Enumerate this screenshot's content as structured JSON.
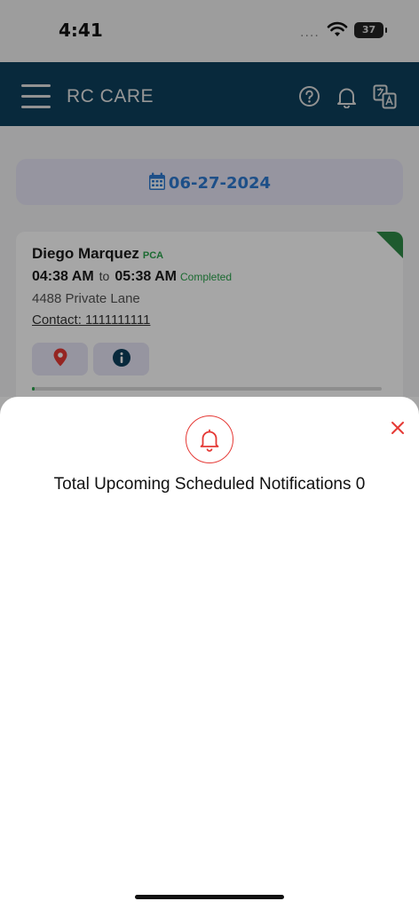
{
  "status_bar": {
    "time": "4:41",
    "signal": "....",
    "battery": "37"
  },
  "header": {
    "title": "RC CARE",
    "color": "#0d3f5c",
    "icons": [
      "menu-icon",
      "help-icon",
      "bell-icon",
      "translate-icon"
    ]
  },
  "date_selector": {
    "date": "06-27-2024",
    "icon": "calendar-icon"
  },
  "visit_card": {
    "patient_name": "Diego Marquez",
    "role": "PCA",
    "start_time": "04:38 AM",
    "separator": "to",
    "end_time": "05:38 AM",
    "status": "Completed",
    "address": "4488 Private Lane",
    "contact": "Contact: 1111111111",
    "buttons": [
      "location-pin-icon",
      "info-icon"
    ],
    "progress": 0.005,
    "status_color": "#2aa44c"
  },
  "notification_sheet": {
    "title": "Total Upcoming Scheduled Notifications 0",
    "icon": "bell-icon",
    "accent": "#e53935"
  }
}
